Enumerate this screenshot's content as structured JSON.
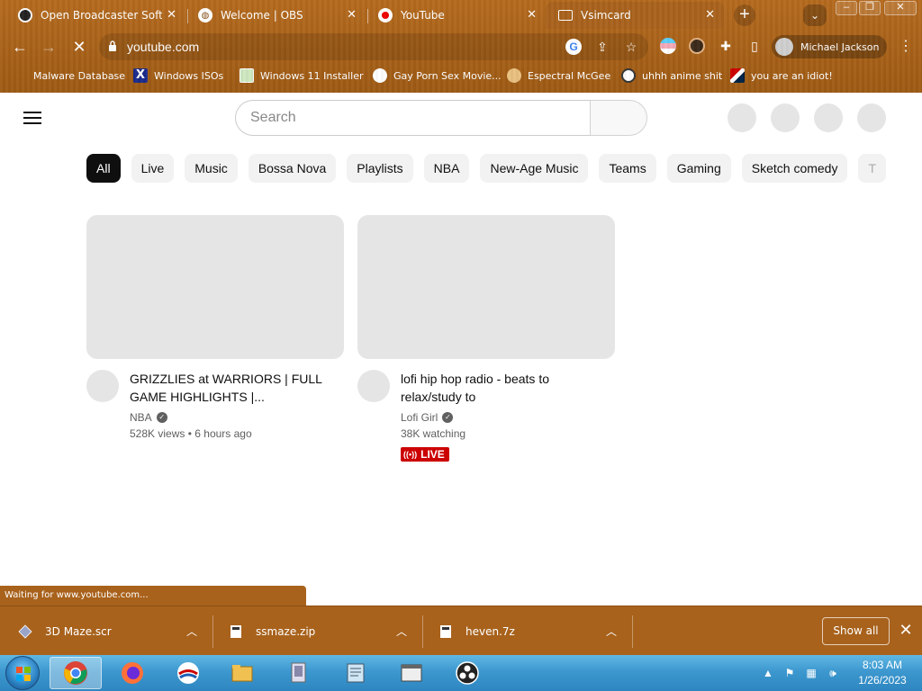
{
  "browser": {
    "tabs": [
      {
        "title": "Open Broadcaster Software",
        "icon": "obs-icon"
      },
      {
        "title": "Welcome | OBS",
        "icon": "globe-icon"
      },
      {
        "title": "YouTube",
        "icon": "youtube-icon"
      },
      {
        "title": "Vsimcard",
        "icon": "sim-card-icon"
      }
    ],
    "url": "youtube.com",
    "profile_name": "Michael Jackson",
    "bookmarks": [
      "Malware Database",
      "Windows ISOs",
      "Windows 11 Installer",
      "Gay Porn Sex Movie...",
      "Espectral McGee",
      "uhhh anime shit",
      "you are an idiot!"
    ],
    "status_text": "Waiting for www.youtube.com..."
  },
  "youtube": {
    "search_placeholder": "Search",
    "chips": [
      "All",
      "Live",
      "Music",
      "Bossa Nova",
      "Playlists",
      "NBA",
      "New-Age Music",
      "Teams",
      "Gaming",
      "Sketch comedy",
      "T"
    ],
    "videos": [
      {
        "title": "GRIZZLIES at WARRIORS | FULL GAME HIGHLIGHTS |...",
        "channel": "NBA",
        "views": "528K views",
        "age": "6 hours ago"
      },
      {
        "title": "lofi hip hop radio - beats to relax/study to",
        "channel": "Lofi Girl",
        "views": "38K watching",
        "badge": "LIVE"
      }
    ]
  },
  "downloads": [
    {
      "name": "3D Maze.scr"
    },
    {
      "name": "ssmaze.zip"
    },
    {
      "name": "heven.7z"
    }
  ],
  "downloads_show_all": "Show all",
  "taskbar": {
    "time": "8:03 AM",
    "date": "1/26/2023"
  },
  "colors": {
    "chrome_theme": "#a8621c",
    "yt_chip_selected": "#0f0f0f",
    "live_red": "#cc0000",
    "taskbar_blue": "#3d98cf"
  }
}
